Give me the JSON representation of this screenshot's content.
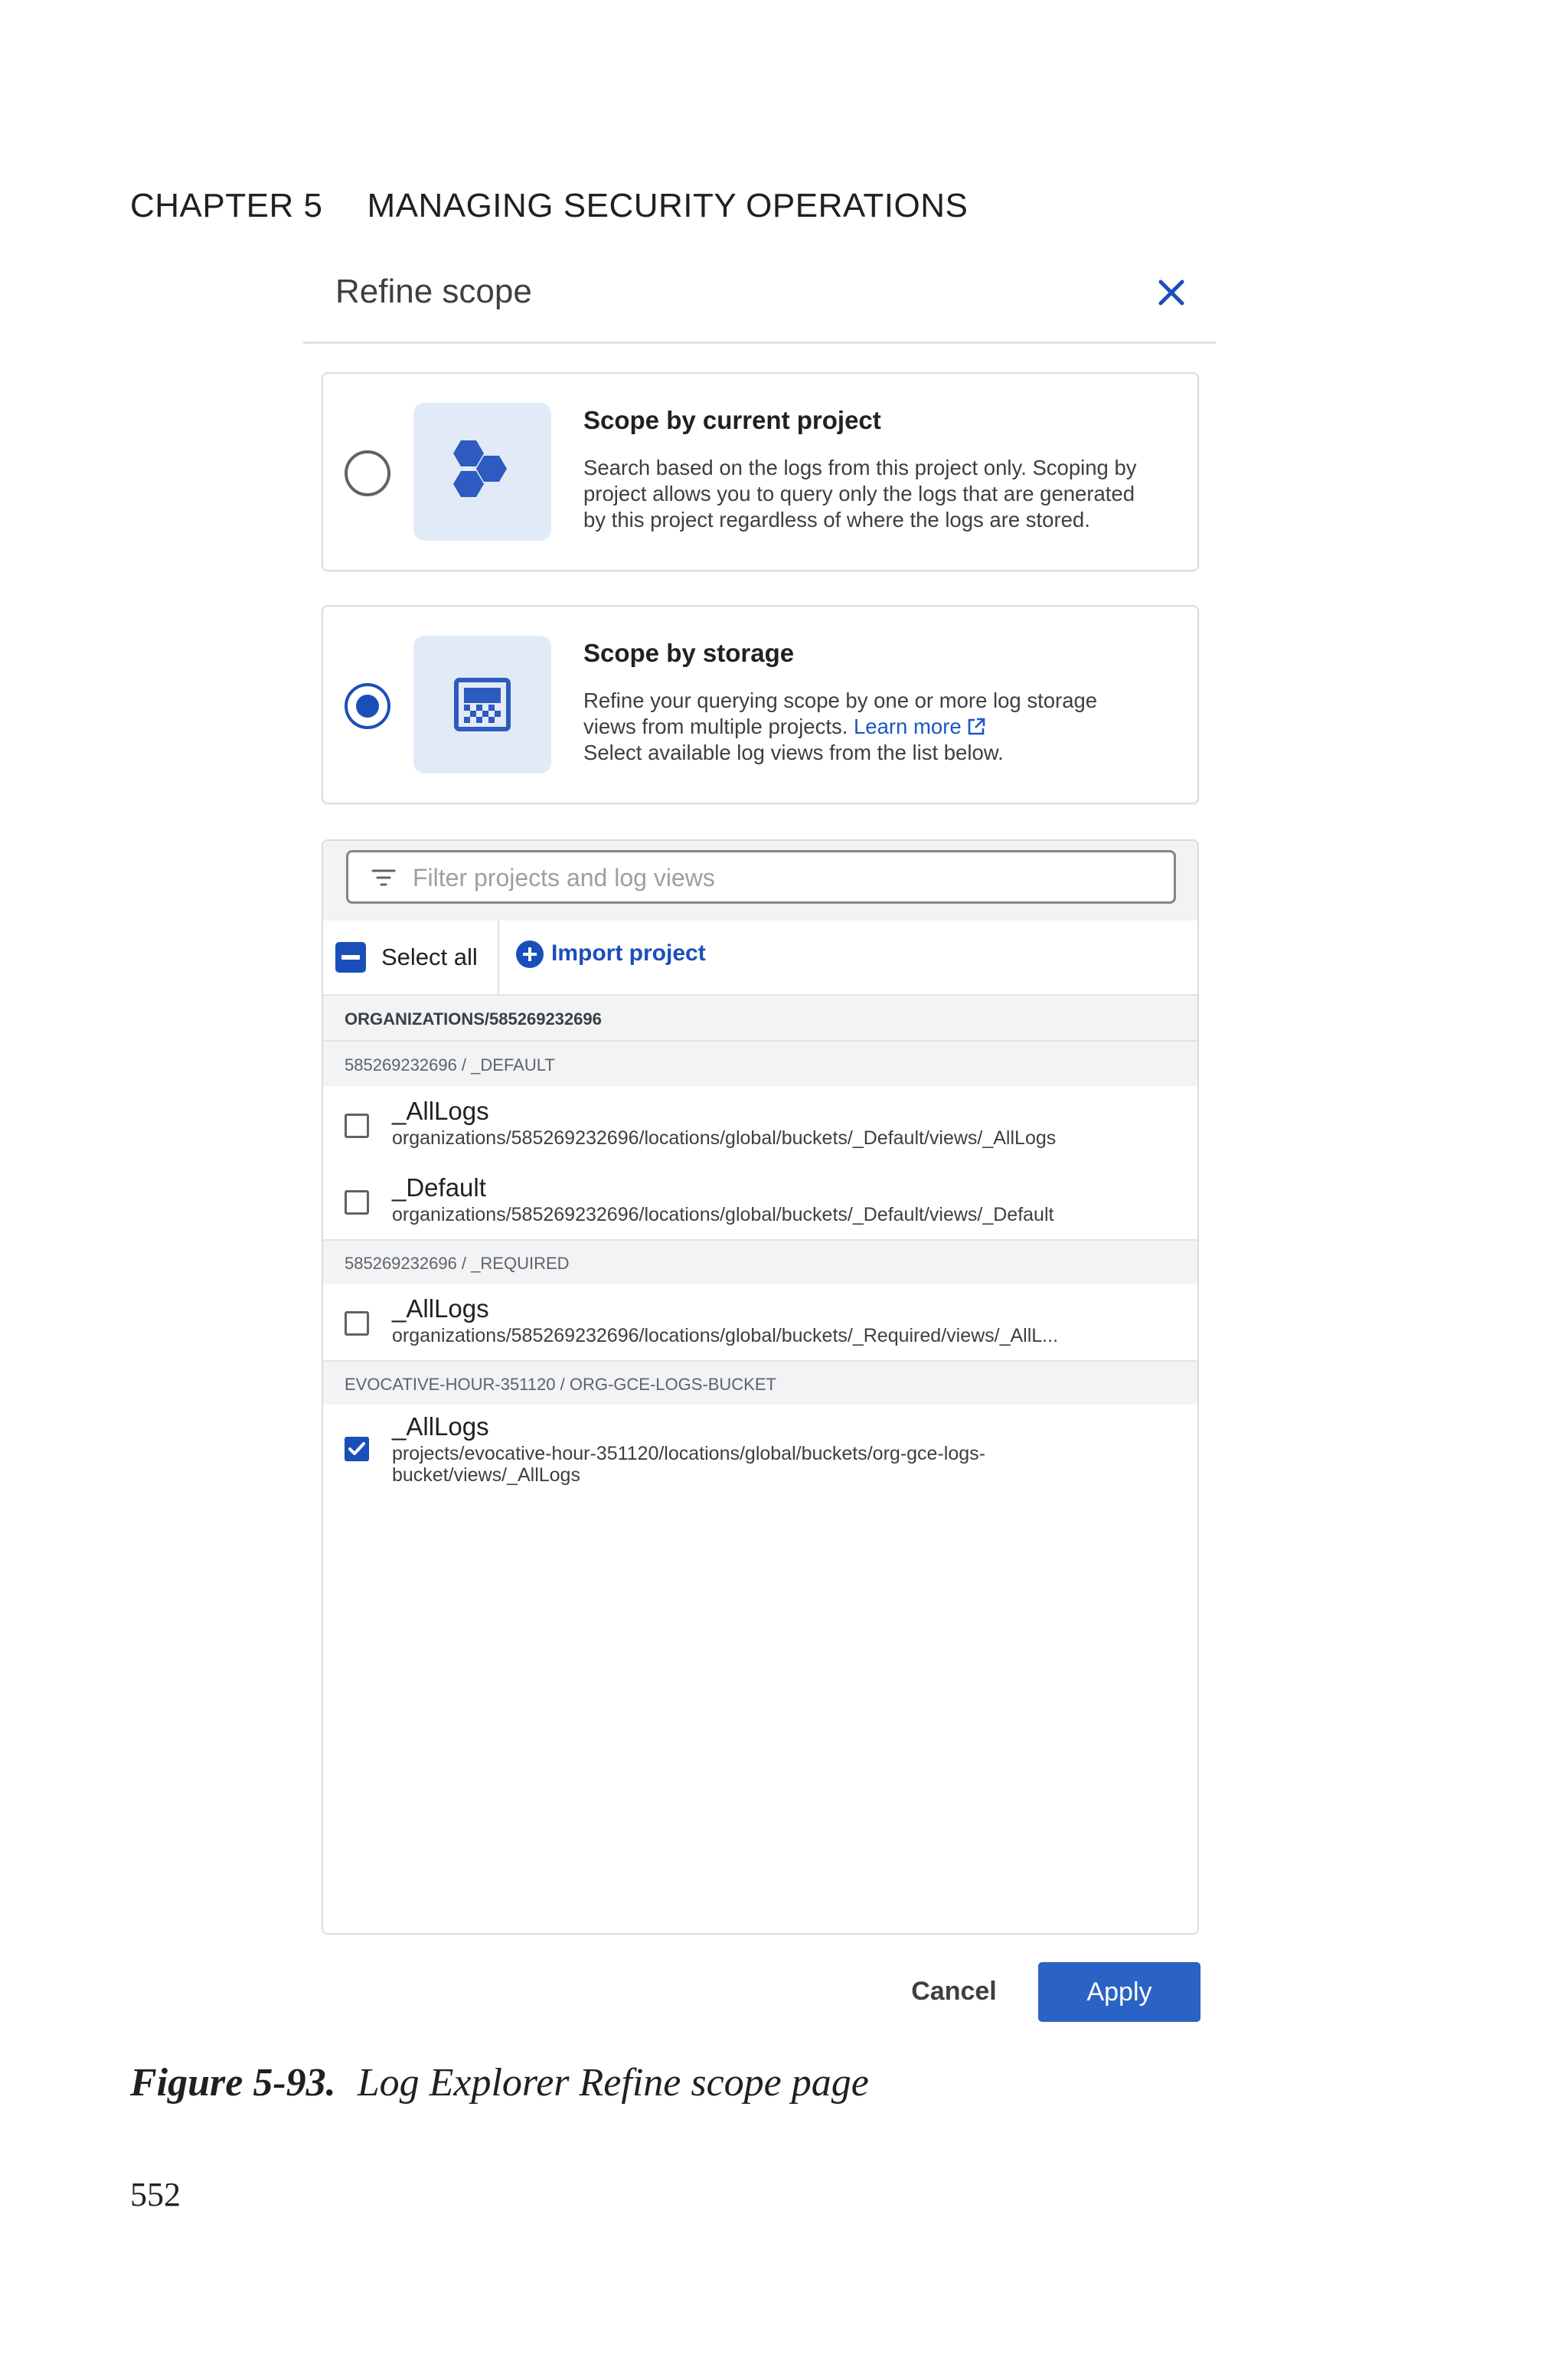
{
  "running_head": {
    "chapter": "CHAPTER 5",
    "title": "MANAGING SECURITY OPERATIONS"
  },
  "dialog": {
    "title": "Refine scope",
    "close_icon": "close-icon",
    "options": [
      {
        "heading": "Scope by current project",
        "description_lines": [
          "Search based on the logs from this project only. Scoping by",
          "project allows you to query only the logs that are generated",
          "by this project regardless of where the logs are stored."
        ],
        "icon": "project-hexagons-icon",
        "selected": false
      },
      {
        "heading": "Scope by storage",
        "description_lines": [
          "Refine your querying scope by one or more log storage",
          "views from multiple projects.",
          "Select available log views from the list below."
        ],
        "link_text": "Learn more",
        "icon": "log-storage-icon",
        "selected": true
      }
    ],
    "filter": {
      "placeholder": "Filter projects and log views",
      "value": ""
    },
    "toolbar": {
      "select_all": "Select all",
      "import_project": "Import project"
    },
    "list": {
      "org_header": "ORGANIZATIONS/585269232696",
      "groups": [
        {
          "header": "585269232696 / _DEFAULT",
          "items": [
            {
              "name": "_AllLogs",
              "path": "organizations/585269232696/locations/global/buckets/_Default/views/_AllLogs",
              "checked": false
            },
            {
              "name": "_Default",
              "path": "organizations/585269232696/locations/global/buckets/_Default/views/_Default",
              "checked": false
            }
          ]
        },
        {
          "header": "585269232696 / _REQUIRED",
          "items": [
            {
              "name": "_AllLogs",
              "path": "organizations/585269232696/locations/global/buckets/_Required/views/_AllL...",
              "checked": false
            }
          ]
        },
        {
          "header": "EVOCATIVE-HOUR-351120 / ORG-GCE-LOGS-BUCKET",
          "items": [
            {
              "name": "_AllLogs",
              "path_lines": [
                "projects/evocative-hour-351120/locations/global/buckets/org-gce-logs-",
                "bucket/views/_AllLogs"
              ],
              "checked": true
            }
          ]
        }
      ]
    },
    "buttons": {
      "cancel": "Cancel",
      "apply": "Apply"
    },
    "colors": {
      "accent": "#1a4fba",
      "apply_bg": "#2b63c4",
      "tile_bg": "#e3eaf7",
      "link": "#1a57c7"
    }
  },
  "caption": {
    "number": "Figure 5-93.",
    "text": "Log Explorer Refine scope page"
  },
  "page_number": "552"
}
